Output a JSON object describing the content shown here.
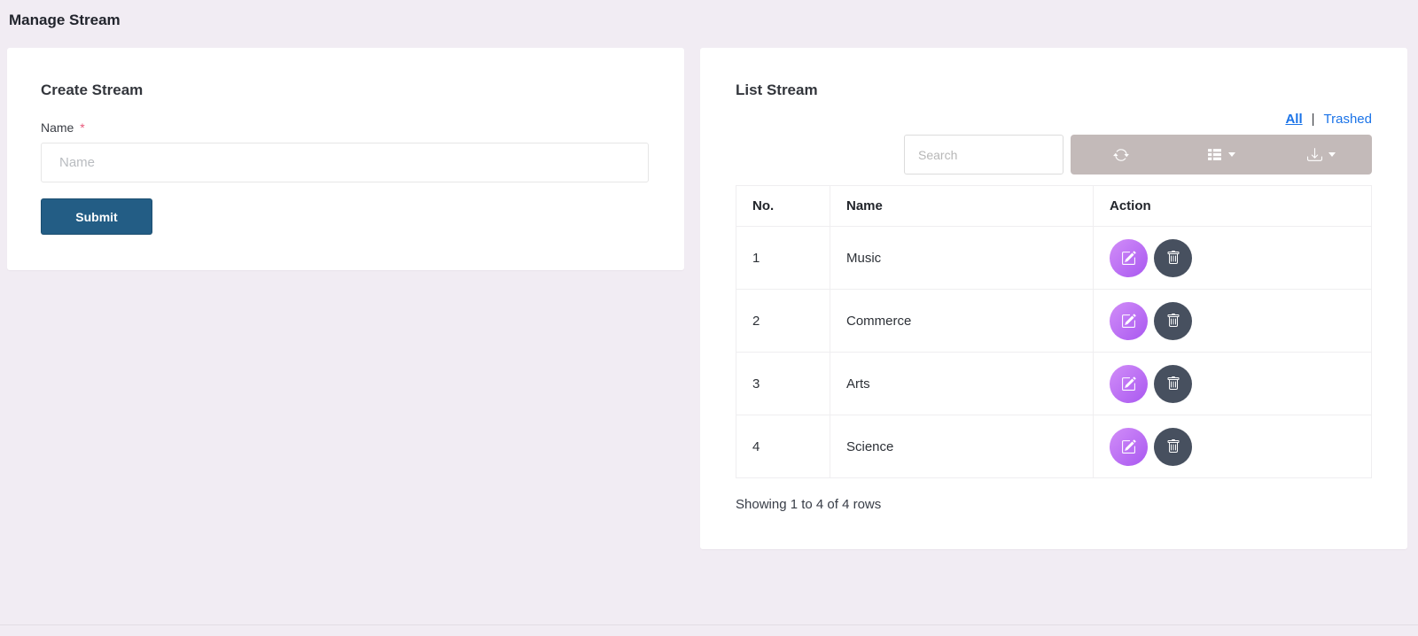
{
  "page": {
    "title": "Manage Stream"
  },
  "create_card": {
    "title": "Create Stream",
    "name_label": "Name",
    "required_marker": "*",
    "name_placeholder": "Name",
    "submit_label": "Submit"
  },
  "list_card": {
    "title": "List Stream",
    "filters": {
      "all": "All",
      "separator": "|",
      "trashed": "Trashed"
    },
    "search_placeholder": "Search",
    "toolbar_icons": [
      "refresh-icon",
      "columns-icon",
      "export-icon"
    ],
    "table": {
      "headers": [
        "No.",
        "Name",
        "Action"
      ],
      "rows": [
        {
          "no": "1",
          "name": "Music"
        },
        {
          "no": "2",
          "name": "Commerce"
        },
        {
          "no": "3",
          "name": "Arts"
        },
        {
          "no": "4",
          "name": "Science"
        }
      ],
      "row_actions": [
        "edit",
        "delete"
      ]
    },
    "summary": "Showing 1 to 4 of 4 rows"
  },
  "colors": {
    "background": "#f1ecf3",
    "card": "#ffffff",
    "submit": "#235d85",
    "link": "#1a73e8",
    "toolbar_group": "#c3bab9",
    "edit_button_from": "#d18df8",
    "edit_button_to": "#a958f0",
    "delete_button": "#47505f",
    "required": "#e8597b"
  }
}
